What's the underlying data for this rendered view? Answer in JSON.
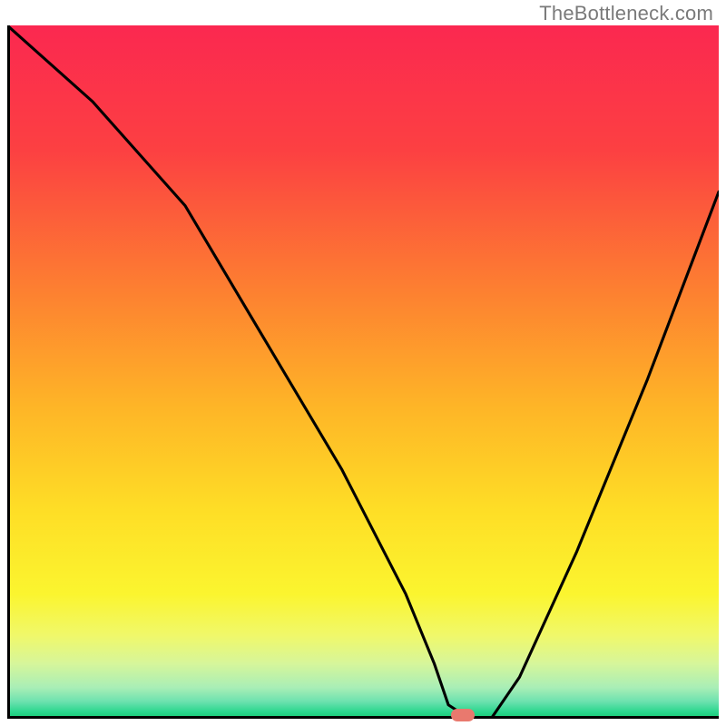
{
  "watermark": "TheBottleneck.com",
  "chart_data": {
    "type": "line",
    "title": "",
    "xlabel": "",
    "ylabel": "",
    "xlim": [
      0,
      100
    ],
    "ylim": [
      0,
      100
    ],
    "marker_x": 64,
    "series": [
      {
        "name": "curve",
        "x": [
          0,
          12,
          25,
          36,
          47,
          56,
          60,
          62,
          65,
          68,
          72,
          80,
          90,
          100
        ],
        "values": [
          100,
          89,
          74,
          55,
          36,
          18,
          8,
          2,
          0,
          0,
          6,
          24,
          49,
          76
        ]
      }
    ],
    "background": {
      "type": "vertical_gradient",
      "stops": [
        {
          "pos": 0.0,
          "color": "#fb2850"
        },
        {
          "pos": 0.18,
          "color": "#fc4042"
        },
        {
          "pos": 0.38,
          "color": "#fd7f31"
        },
        {
          "pos": 0.55,
          "color": "#feb527"
        },
        {
          "pos": 0.7,
          "color": "#fede26"
        },
        {
          "pos": 0.82,
          "color": "#fbf52f"
        },
        {
          "pos": 0.88,
          "color": "#f0f86a"
        },
        {
          "pos": 0.92,
          "color": "#d7f69a"
        },
        {
          "pos": 0.955,
          "color": "#a9eeb6"
        },
        {
          "pos": 0.975,
          "color": "#6de2af"
        },
        {
          "pos": 0.99,
          "color": "#2bd68e"
        },
        {
          "pos": 1.0,
          "color": "#14c971"
        }
      ]
    }
  }
}
